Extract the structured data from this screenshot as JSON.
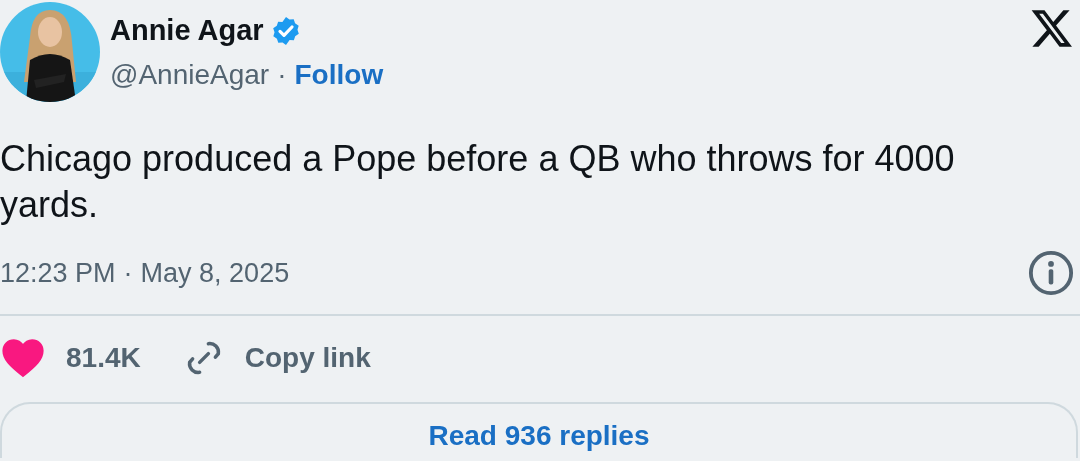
{
  "author": {
    "name": "Annie Agar",
    "verified": true,
    "handle": "@AnnieAgar",
    "separator": "·",
    "follow": "Follow"
  },
  "post": {
    "text": "Chicago produced a Pope before a QB who throws for 4000 yards.",
    "time": "12:23 PM",
    "time_separator": "·",
    "date": "May 8, 2025"
  },
  "actions": {
    "likes": "81.4K",
    "liked": true,
    "copy_link": "Copy link"
  },
  "replies_button": "Read 936 replies"
}
